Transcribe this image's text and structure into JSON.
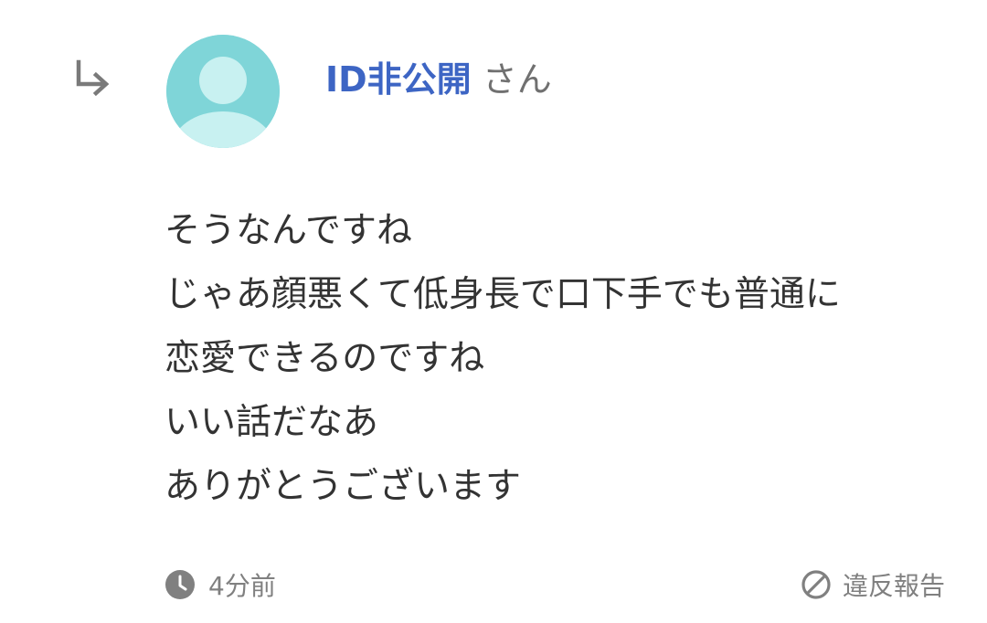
{
  "comment": {
    "user": {
      "name": "ID非公開",
      "suffix": "さん"
    },
    "lines": [
      "そうなんですね",
      "じゃあ顔悪くて低身長で口下手でも普通に",
      "恋愛できるのですね",
      "いい話だなあ",
      "ありがとうございます"
    ],
    "time_ago": "4分前",
    "report_label": "違反報告"
  },
  "icons": {
    "reply": "reply-arrow-icon",
    "avatar": "default-user-avatar-icon",
    "time": "clock-icon",
    "report": "prohibited-icon"
  },
  "colors": {
    "username": "#3d65c4",
    "avatar_bg": "#7fd5d8",
    "avatar_figure": "#c8f1f1",
    "muted": "#808080",
    "text": "#333333"
  }
}
